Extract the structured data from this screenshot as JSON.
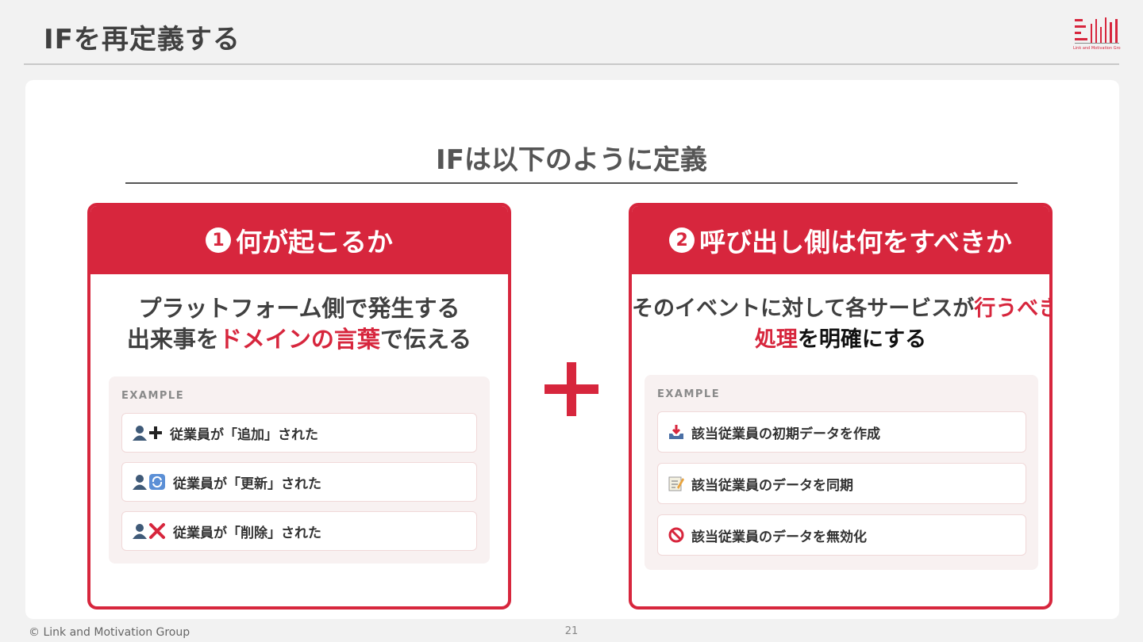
{
  "page": {
    "title": "IFを再定義する",
    "logo_text": "Link and Motivation Group",
    "footer": "© Link and Motivation Group",
    "page_number": "21"
  },
  "colors": {
    "accent": "#d7263d",
    "heading": "#555555",
    "example_bg": "#f8f1f1"
  },
  "section": {
    "heading": "IFは以下のように定義"
  },
  "left_panel": {
    "number": "1",
    "title": "何が起こるか",
    "lead_line1": "プラットフォーム側で発生する",
    "lead_line2_pre": "出来事を",
    "lead_line2_hl": "ドメインの言葉",
    "lead_line2_post": "で伝える",
    "example_label": "EXAMPLE",
    "items": [
      {
        "icon": "user-add-icon",
        "text": "従業員が「追加」された"
      },
      {
        "icon": "user-update-icon",
        "text": "従業員が「更新」された"
      },
      {
        "icon": "user-delete-icon",
        "text": "従業員が「削除」された"
      }
    ]
  },
  "right_panel": {
    "number": "2",
    "title": "呼び出し側は何をすべきか",
    "lead_line1_pre": "そのイベントに対して各サービスが",
    "lead_line1_hl": "行うべき",
    "lead_line2_hl": "処理",
    "lead_line2_post": "を明確にする",
    "example_label": "EXAMPLE",
    "items": [
      {
        "icon": "inbox-tray-icon",
        "text": "該当従業員の初期データを作成"
      },
      {
        "icon": "memo-icon",
        "text": "該当従業員のデータを同期"
      },
      {
        "icon": "prohibited-icon",
        "text": "該当従業員のデータを無効化"
      }
    ]
  }
}
